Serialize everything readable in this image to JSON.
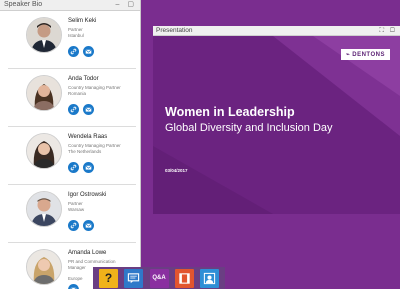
{
  "speaker_bio": {
    "title": "Speaker Bio",
    "controls": "–  ▢",
    "speakers": [
      {
        "name": "Selim Keki",
        "role": "Partner",
        "location": "Istanbul",
        "icons": [
          "link-icon",
          "email-icon"
        ]
      },
      {
        "name": "Anda Todor",
        "role": "Country Managing Partner",
        "location": "Romania",
        "icons": [
          "link-icon",
          "email-icon"
        ]
      },
      {
        "name": "Wendela Raas",
        "role": "Country Managing Partner",
        "location": "The Netherlands",
        "icons": [
          "link-icon",
          "email-icon"
        ]
      },
      {
        "name": "Igor Ostrowski",
        "role": "Partner",
        "location": "Warsaw",
        "icons": [
          "link-icon",
          "email-icon"
        ]
      },
      {
        "name": "Amanda Lowe",
        "role": "PR and Communication Manager",
        "location": "Europe",
        "icons": [
          "email-icon"
        ]
      }
    ]
  },
  "presentation": {
    "title": "Presentation",
    "controls": "⛶ ▢",
    "slide": {
      "logo": "⌁ DENTONS",
      "title": "Women in Leadership",
      "subtitle": "Global Diversity and Inclusion Day",
      "date": "03/04/2017"
    }
  },
  "toolbar": {
    "help_label": "?",
    "qa_label": "Q&A",
    "buttons": [
      "help-icon",
      "chat-icon",
      "qa-icon",
      "media-icon",
      "people-icon"
    ]
  },
  "colors": {
    "brand_purple": "#7a2d8f",
    "accent_blue": "#1a79c9",
    "help_yellow": "#f0b21a",
    "media_orange": "#e2552f"
  }
}
